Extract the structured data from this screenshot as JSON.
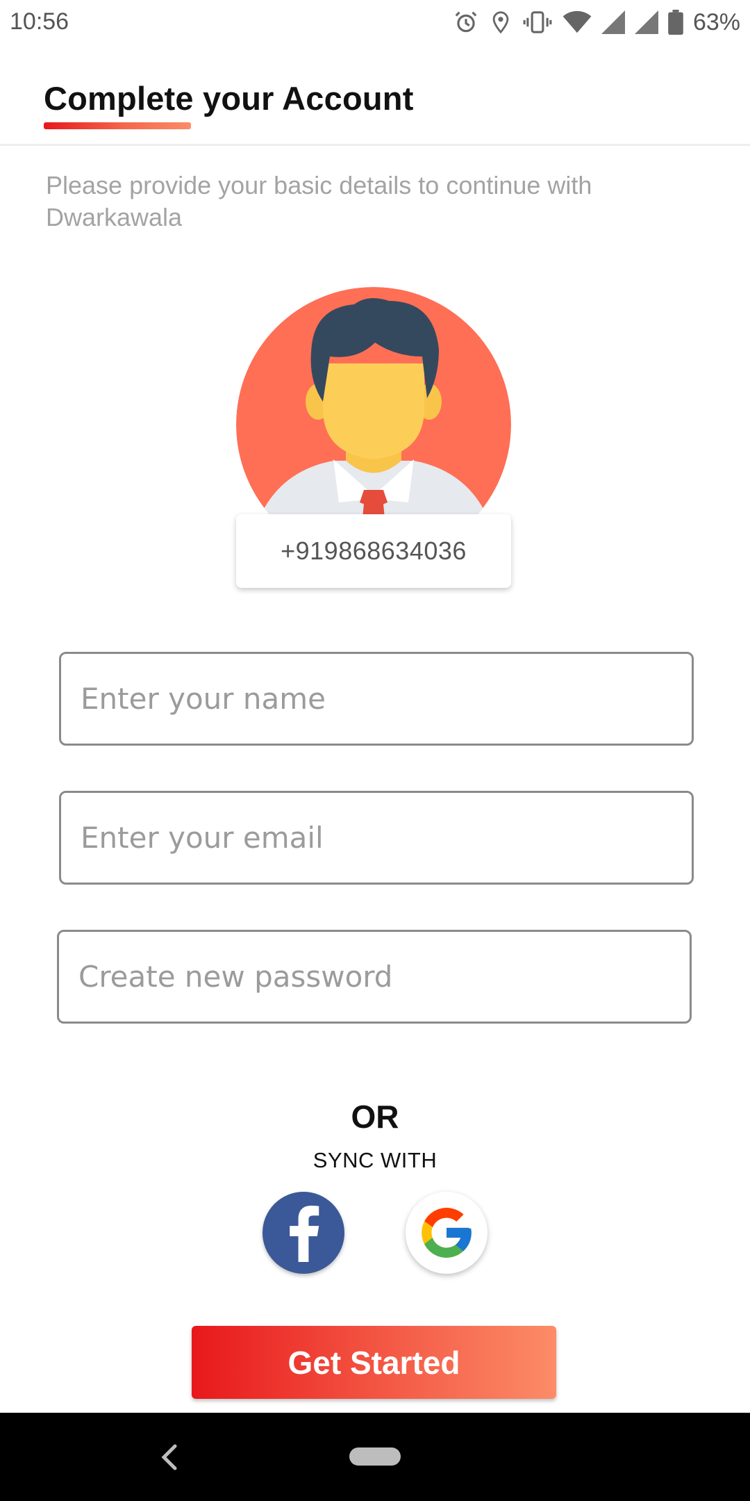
{
  "status_bar": {
    "time": "10:56",
    "battery": "63%",
    "icons": [
      "alarm-icon",
      "location-icon",
      "vibrate-icon",
      "wifi-icon",
      "signal-icon",
      "signal-icon",
      "battery-icon"
    ]
  },
  "header": {
    "title": "Complete your Account"
  },
  "subtitle": "Please provide your basic details to continue with Dwarkawala",
  "profile": {
    "phone": "+919868634036"
  },
  "form": {
    "name_placeholder": "Enter your name",
    "email_placeholder": "Enter your email",
    "password_placeholder": "Create new password",
    "name_value": "",
    "email_value": "",
    "password_value": ""
  },
  "divider": {
    "or_label": "OR",
    "sync_label": "SYNC WITH"
  },
  "social": [
    "facebook-icon",
    "google-icon"
  ],
  "cta": {
    "label": "Get Started"
  },
  "colors": {
    "accent_start": "#e8181b",
    "accent_end": "#fc8c68",
    "facebook": "#3b5998",
    "avatar_bg": "#fe6f55"
  }
}
